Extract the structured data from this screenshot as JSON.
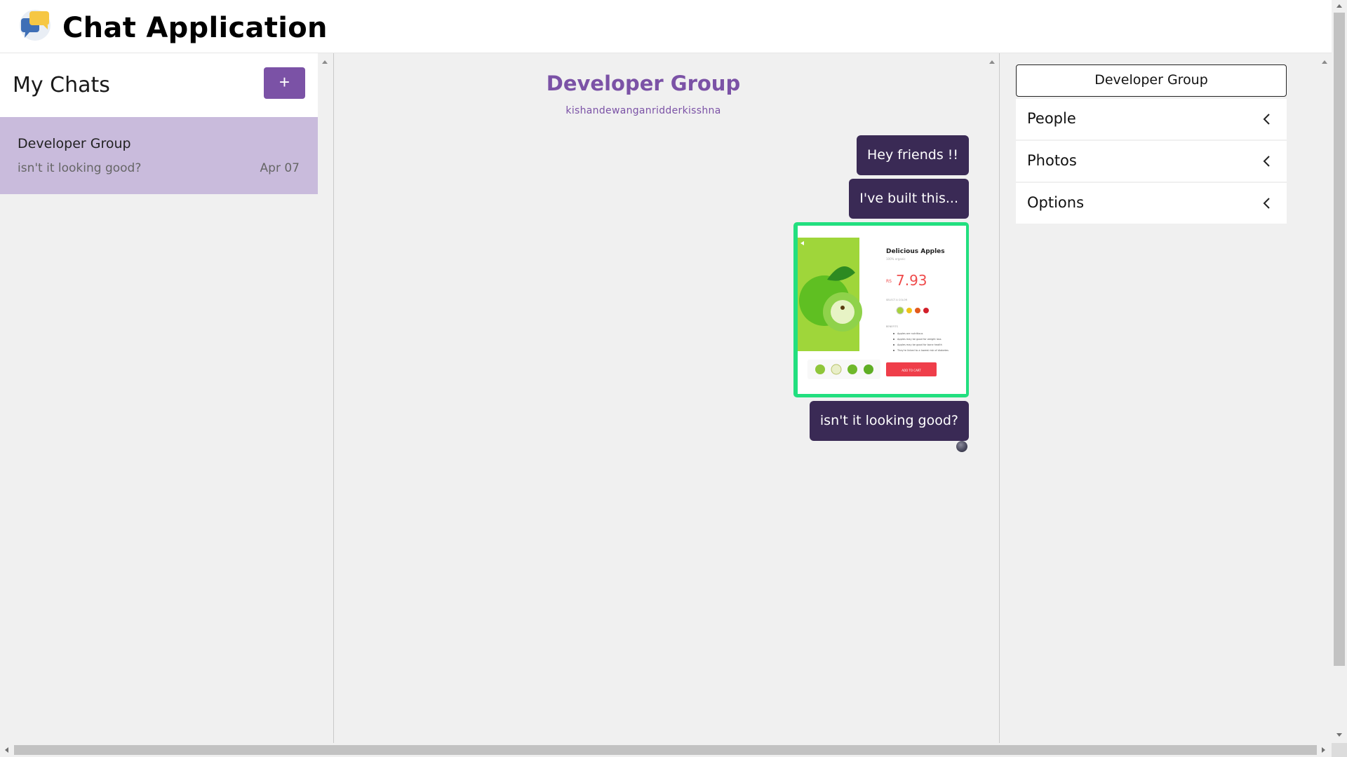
{
  "header": {
    "app_title": "Chat Application",
    "logo_icon": "chat-bubbles-icon"
  },
  "sidebar": {
    "title": "My Chats",
    "new_chat_label": "+",
    "chats": [
      {
        "name": "Developer Group",
        "last_message": "isn't it looking good?",
        "date": "Apr 07",
        "selected": true
      }
    ]
  },
  "conversation": {
    "title": "Developer Group",
    "members": "kishandewanganridderkisshna",
    "messages": [
      {
        "type": "text",
        "text": "Hey friends !!"
      },
      {
        "type": "text",
        "text": "I've built this..."
      },
      {
        "type": "image",
        "image": {
          "product_title": "Delicious Apples",
          "product_subtitle": "100% organic",
          "currency": "RS",
          "price": "7.93",
          "color_label": "SELECT A COLOR",
          "benefits_label": "BENEFITS",
          "benefits": [
            "Apples are nutritious",
            "Apples may be good for weight loss",
            "Apples may be good for bone health",
            "They're linked to a lowest risk of diabetes"
          ],
          "cta": "ADD TO CART"
        }
      },
      {
        "type": "text",
        "text": "isn't it looking good?"
      }
    ]
  },
  "details": {
    "group_name": "Developer Group",
    "sections": [
      {
        "label": "People",
        "icon": "chevron-left-icon"
      },
      {
        "label": "Photos",
        "icon": "chevron-left-icon"
      },
      {
        "label": "Options",
        "icon": "chevron-left-icon"
      }
    ]
  },
  "colors": {
    "accent": "#7b52a6",
    "selected_chat_bg": "#c9bbdc",
    "message_bubble": "#3a2a55",
    "image_frame": "#22df7f",
    "panel_bg": "#f0f0f0"
  }
}
